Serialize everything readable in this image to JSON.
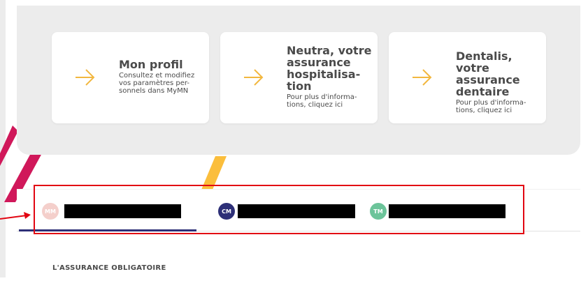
{
  "cards": [
    {
      "title_lines": [
        "Mon profil"
      ],
      "desc_lines": [
        "Consultez et modifiez",
        "vos paramètres per-",
        "sonnels dans MyMN"
      ],
      "icon": "arrow-right-icon"
    },
    {
      "title_lines": [
        "Neutra, votre",
        "assurance",
        "hospitalisa-",
        "tion"
      ],
      "desc_lines": [
        "Pour plus d'informa-",
        "tions, cliquez ici"
      ],
      "icon": "arrow-right-icon"
    },
    {
      "title_lines": [
        "Dentalis, votre",
        "assurance",
        "dentaire"
      ],
      "desc_lines": [
        "Pour plus d'informa-",
        "tions, cliquez ici"
      ],
      "icon": "arrow-right-icon"
    }
  ],
  "tabs": [
    {
      "initials": "MM",
      "color": "#f4cfcb",
      "active": true
    },
    {
      "initials": "CM",
      "color": "#2d2f77",
      "active": false
    },
    {
      "initials": "TM",
      "color": "#6cc49a",
      "active": false
    }
  ],
  "section": {
    "heading": "L'ASSURANCE OBLIGATOIRE"
  },
  "colors": {
    "accent_arrow": "#f2b73f",
    "highlight_box": "#e20612",
    "tab_underline": "#2d2f77",
    "deco_magenta": "#d0185a",
    "deco_yellow": "#fbbe3c"
  }
}
